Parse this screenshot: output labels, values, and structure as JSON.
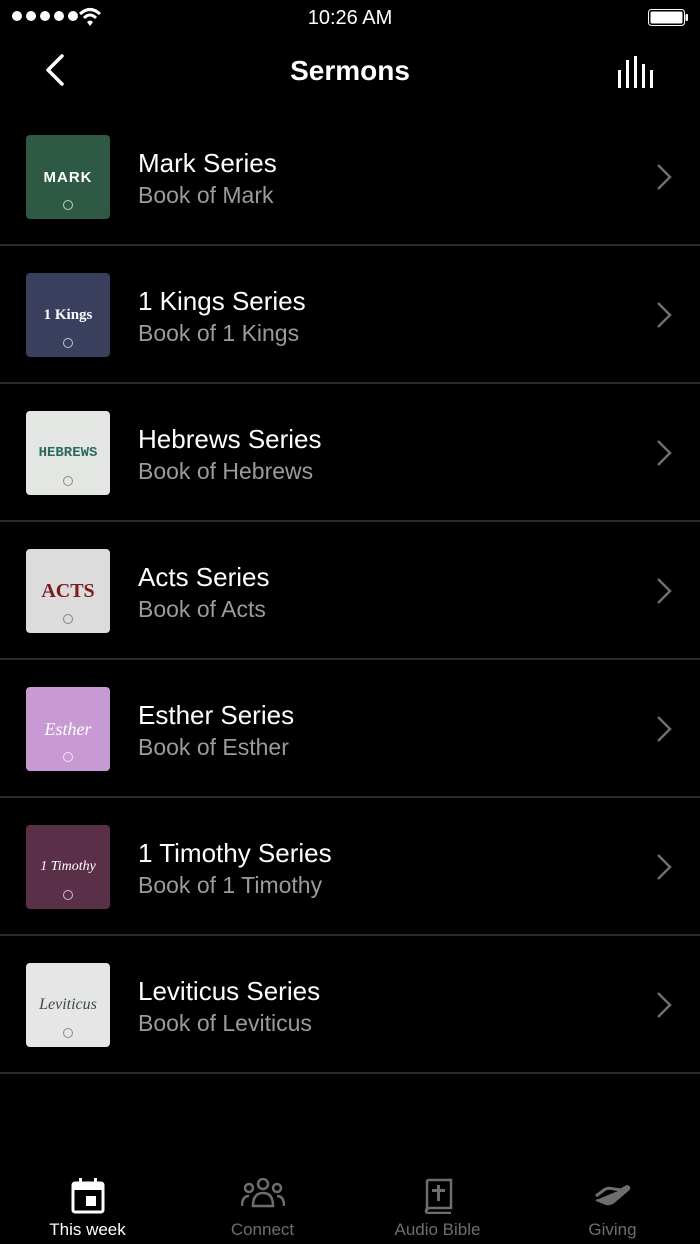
{
  "status_bar": {
    "time": "10:26 AM"
  },
  "nav": {
    "title": "Sermons"
  },
  "series": [
    {
      "title": "Mark Series",
      "subtitle": "Book of Mark",
      "thumb_text": "MARK",
      "thumb_bg": "#2e5a45",
      "thumb_fg": "#ffffff"
    },
    {
      "title": "1 Kings Series",
      "subtitle": "Book of 1 Kings",
      "thumb_text": "1 Kings",
      "thumb_bg": "#3a3f5e",
      "thumb_fg": "#ffffff"
    },
    {
      "title": "Hebrews Series",
      "subtitle": "Book of Hebrews",
      "thumb_text": "HEBREWS",
      "thumb_bg": "#e4e6e3",
      "thumb_fg": "#2d6b5e"
    },
    {
      "title": "Acts Series",
      "subtitle": "Book of Acts",
      "thumb_text": "ACTS",
      "thumb_bg": "#dcdcdc",
      "thumb_fg": "#7a1c1c"
    },
    {
      "title": "Esther Series",
      "subtitle": "Book of Esther",
      "thumb_text": "Esther",
      "thumb_bg": "#c79ad3",
      "thumb_fg": "#ffffff"
    },
    {
      "title": "1 Timothy Series",
      "subtitle": "Book of 1 Timothy",
      "thumb_text": "1 Timothy",
      "thumb_bg": "#5a3048",
      "thumb_fg": "#ffffff"
    },
    {
      "title": "Leviticus Series",
      "subtitle": "Book of Leviticus",
      "thumb_text": "Leviticus",
      "thumb_bg": "#e6e6e6",
      "thumb_fg": "#3c4b45"
    }
  ],
  "tabs": [
    {
      "label": "This week",
      "icon": "calendar-icon",
      "active": true
    },
    {
      "label": "Connect",
      "icon": "group-icon",
      "active": false
    },
    {
      "label": "Audio Bible",
      "icon": "bible-icon",
      "active": false
    },
    {
      "label": "Giving",
      "icon": "giving-hand-icon",
      "active": false
    }
  ],
  "colors": {
    "background": "#000000",
    "subtitle": "#9b9b9b",
    "tab_inactive": "#6e6e6e",
    "tab_active": "#ffffff"
  }
}
